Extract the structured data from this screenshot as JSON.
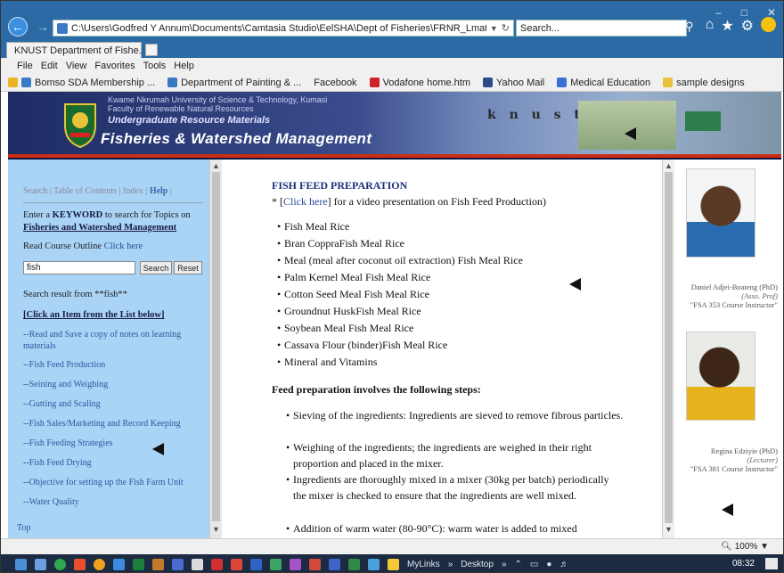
{
  "browser": {
    "address": "C:\\Users\\Godfred Y Annum\\Documents\\Camtasia Studio\\EelSHA\\Dept of Fisheries\\FRNR_Lmat\\FRNR\\recds\\dbæ",
    "search_placeholder": "Search...",
    "tab_title": "KNUST Department of Fishe...",
    "menu": [
      "File",
      "Edit",
      "View",
      "Favorites",
      "Tools",
      "Help"
    ],
    "favorites": [
      "Bomso SDA Membership ...",
      "Department of Painting & ...",
      "Facebook",
      "Vodafone home.htm",
      "Yahoo Mail",
      "Medical Education",
      "sample designs"
    ],
    "zoom": "100%"
  },
  "banner": {
    "university": "Kwame Nkrumah University of Science & Technology, Kumasi",
    "faculty": "Faculty of Renewable Natural Resources",
    "subtitle": "Undergraduate Resource Materials",
    "title": "Fisheries & Watershed Management",
    "knust": "k n u s t"
  },
  "sidebar": {
    "nav_search": "Search",
    "nav_toc": "Table of Contents",
    "nav_index": "Index",
    "nav_help": "Help",
    "keyword_line1": "Enter a",
    "keyword_bold": "KEYWORD",
    "keyword_line2": "to search for Topics on",
    "keyword_subject": "Fisheries and Watershed Management",
    "outline_text": "Read Course Outline",
    "outline_link": "Click here",
    "search_value": "fish",
    "search_button": "Search",
    "reset_button": "Reset",
    "result_text": "Search result from **fish**",
    "click_item": "[Click an Item from the List below]",
    "items": [
      "--Read and Save a copy of notes on learning materials",
      "--Fish Feed Production",
      "--Seining and Weighing",
      "--Gutting and Scaling",
      "--Fish Sales/Marketing and Record Keeping",
      "--Fish Feeding Strategies",
      "--Fish Feed Drying",
      "--Objective for setting up the Fish Farm Unit",
      "--Water Quality"
    ],
    "top_link": "Top"
  },
  "content": {
    "heading": "FISH FEED PREPARATION",
    "click_prefix": "* [",
    "click_link": "Click here",
    "click_suffix": "] for a video presentation on Fish Feed Production)",
    "ingredients": [
      "Fish Meal Rice",
      "Bran CoppraFish Meal Rice",
      "Meal (meal after coconut oil extraction) Fish Meal Rice",
      "Palm Kernel Meal Fish Meal Rice",
      "Cotton Seed Meal Fish Meal Rice",
      "Groundnut HuskFish Meal Rice",
      "Soybean Meal Fish Meal Rice",
      "Cassava Flour (binder)Fish Meal Rice",
      "Mineral and Vitamins"
    ],
    "steps_heading": "Feed preparation involves the following steps:",
    "steps": [
      "Sieving of the ingredients: Ingredients are sieved to remove fibrous particles.",
      "Weighing of the ingredients; the ingredients are weighed in their right proportion and placed in the mixer.",
      "Ingredients are thoroughly mixed in a mixer (30kg per batch) periodically the mixer is checked to ensure that the ingredients are well mixed.",
      "Addition of warm water (80-90°C): warm water is added to mixed"
    ]
  },
  "staff": [
    {
      "name": "Daniel Adjei-Boateng (PhD)",
      "role": "(Asso. Prof)",
      "course": "\"FSA 353 Course Instructor\""
    },
    {
      "name": "Regina Edziyie (PhD)",
      "role": "(Lecturer)",
      "course": "\"FSA 381 Course Instructor\""
    }
  ],
  "taskbar": {
    "mylinks": "MyLinks",
    "desktop": "Desktop",
    "clock": "08:32"
  },
  "colors": {
    "chrome": "#2c6aa6",
    "sidebar_bg": "#a9d4f5",
    "heading": "#1d2f7a",
    "link": "#2a4a9c",
    "banner_accent": "#cc2e14"
  }
}
